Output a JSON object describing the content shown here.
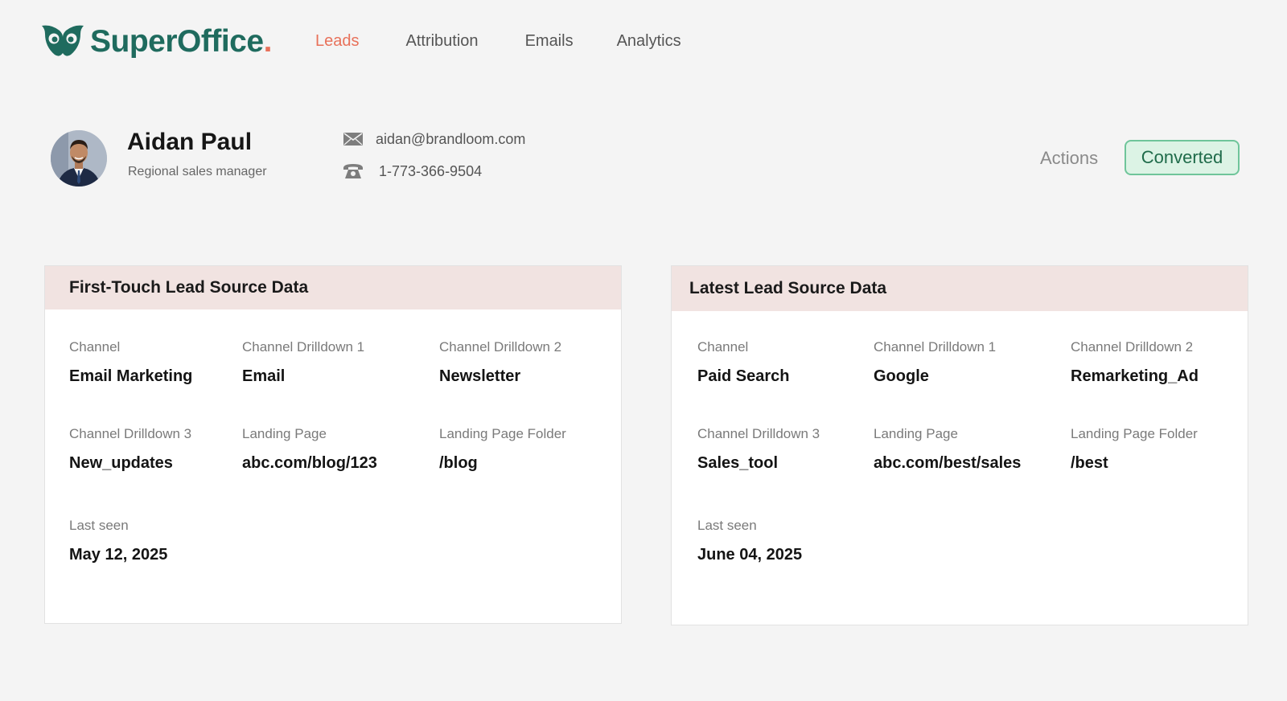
{
  "brand": {
    "name": "SuperOffice",
    "accent": "#1f6b5e",
    "dot_color": "#e8715a"
  },
  "nav": [
    {
      "label": "Leads",
      "active": true
    },
    {
      "label": "Attribution",
      "active": false
    },
    {
      "label": "Emails",
      "active": false
    },
    {
      "label": "Analytics",
      "active": false
    }
  ],
  "profile": {
    "name": "Aidan Paul",
    "role": "Regional sales manager",
    "email": "aidan@brandloom.com",
    "phone": "1-773-366-9504",
    "actions_label": "Actions",
    "status": "Converted",
    "status_color": "#6fc59a"
  },
  "first_touch": {
    "title": "First-Touch Lead Source Data",
    "fields": {
      "channel": {
        "label": "Channel",
        "value": "Email Marketing"
      },
      "drill1": {
        "label": "Channel Drilldown 1",
        "value": "Email"
      },
      "drill2": {
        "label": "Channel Drilldown 2",
        "value": "Newsletter"
      },
      "drill3": {
        "label": "Channel Drilldown 3",
        "value": "New_updates"
      },
      "landing": {
        "label": "Landing Page",
        "value": "abc.com/blog/123"
      },
      "folder": {
        "label": "Landing Page Folder",
        "value": "/blog"
      },
      "last_seen": {
        "label": "Last seen",
        "value": "May 12, 2025"
      }
    }
  },
  "latest": {
    "title": "Latest Lead Source Data",
    "fields": {
      "channel": {
        "label": "Channel",
        "value": "Paid Search"
      },
      "drill1": {
        "label": "Channel Drilldown 1",
        "value": "Google"
      },
      "drill2": {
        "label": "Channel Drilldown 2",
        "value": "Remarketing_Ad"
      },
      "drill3": {
        "label": "Channel Drilldown 3",
        "value": "Sales_tool"
      },
      "landing": {
        "label": "Landing Page",
        "value": "abc.com/best/sales"
      },
      "folder": {
        "label": "Landing Page Folder",
        "value": "/best"
      },
      "last_seen": {
        "label": "Last seen",
        "value": "June 04, 2025"
      }
    }
  }
}
